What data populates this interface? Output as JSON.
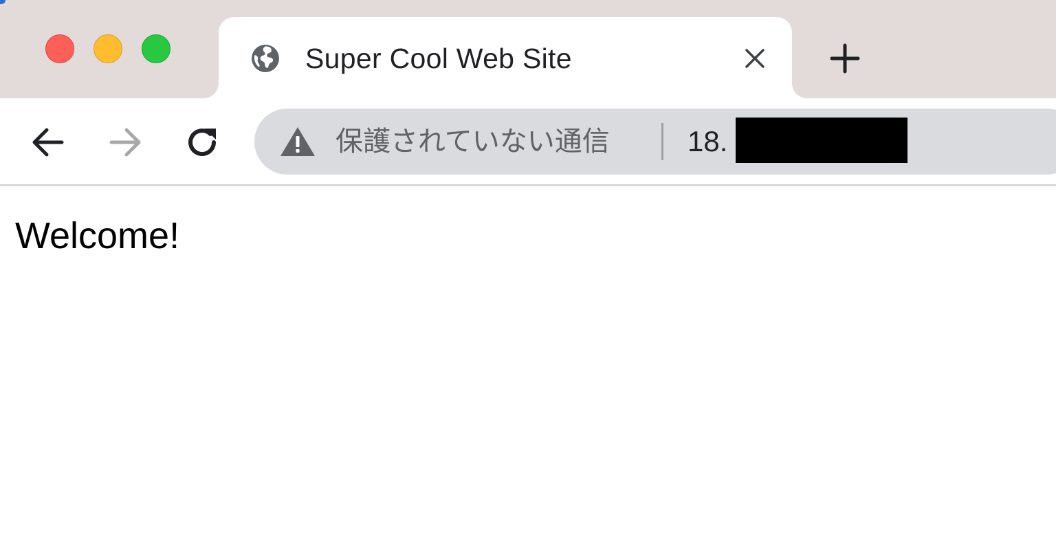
{
  "window": {
    "traffic_lights": [
      "close",
      "minimize",
      "maximize"
    ],
    "colors": {
      "close": "#fe5f57",
      "minimize": "#febc2e",
      "maximize": "#28c840",
      "tabstrip": "#e2dbd9",
      "omnibox": "#dadbde"
    }
  },
  "tab": {
    "favicon": "globe-icon",
    "title": "Super Cool Web Site",
    "close_icon": "close-icon"
  },
  "new_tab_icon": "plus-icon",
  "toolbar": {
    "back_icon": "arrow-left-icon",
    "forward_icon": "arrow-right-icon",
    "reload_icon": "reload-icon"
  },
  "omnibox": {
    "security_icon": "warning-icon",
    "security_label": "保護されていない通信",
    "url": "18."
  },
  "page": {
    "text": "Welcome!"
  }
}
